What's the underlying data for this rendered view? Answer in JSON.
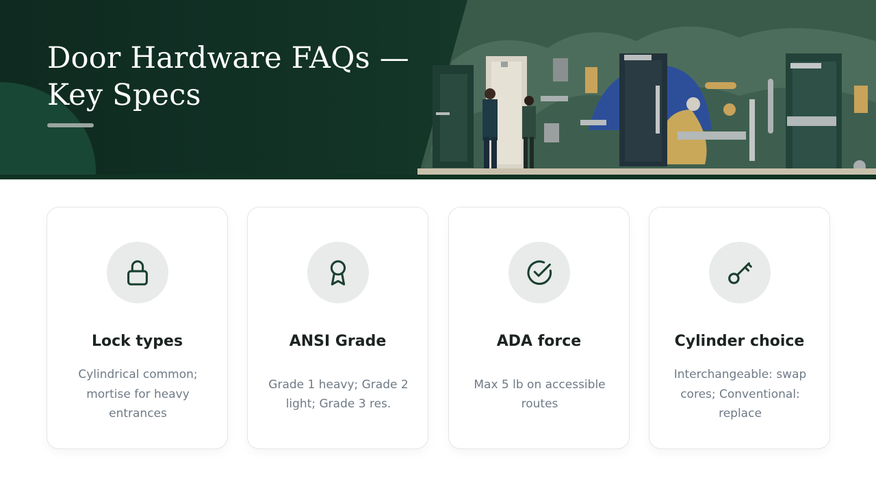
{
  "header": {
    "title_line1": "Door Hardware FAQs —",
    "title_line2": "Key Specs"
  },
  "colors": {
    "header_bg": "#123326",
    "icon_stroke": "#1b3f30",
    "icon_bg": "#e8ebe9",
    "card_title": "#1c2420",
    "card_body": "#6f7a86"
  },
  "cards": [
    {
      "icon": "lock-icon",
      "title": "Lock types",
      "body": "Cylindrical common; mortise for heavy entrances"
    },
    {
      "icon": "award-ribbon-icon",
      "title": "ANSI Grade",
      "body": "Grade 1 heavy; Grade 2 light; Grade 3 res."
    },
    {
      "icon": "check-circle-icon",
      "title": "ADA force",
      "body": "Max 5 lb on accessible routes"
    },
    {
      "icon": "key-icon",
      "title": "Cylinder choice",
      "body": "Interchangeable: swap cores; Conventional: replace"
    }
  ]
}
